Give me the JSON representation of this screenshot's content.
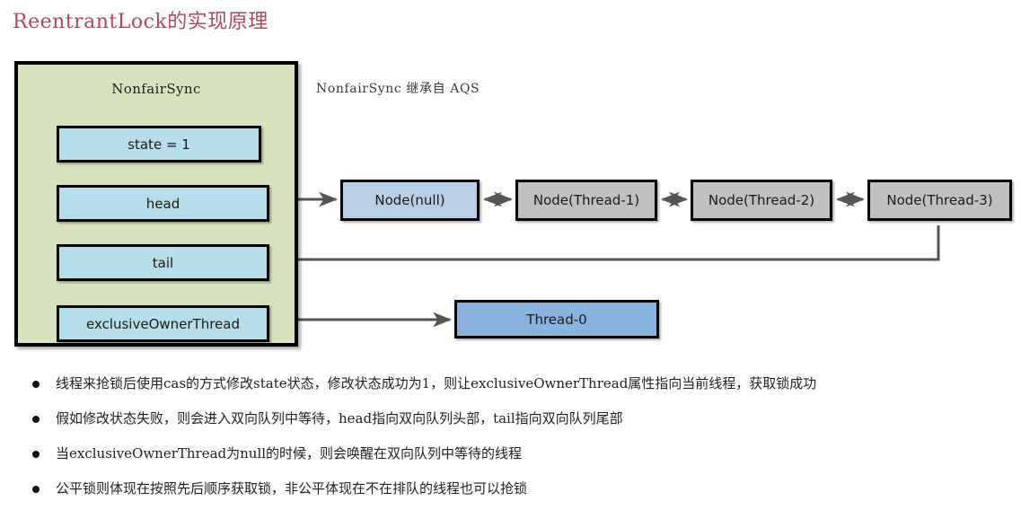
{
  "page": {
    "title": "ReentrantLock的实现原理",
    "title_color": "#b04a5a",
    "background": "#ffffff"
  },
  "diagram": {
    "sync_container": {
      "title": "NonfairSync",
      "fill": "#d6e3bc",
      "border": "#000000",
      "fields": [
        {
          "label": "state = 1",
          "fill": "#b7dee8"
        },
        {
          "label": "head",
          "fill": "#b7dee8"
        },
        {
          "label": "tail",
          "fill": "#b7dee8"
        },
        {
          "label": "exclusiveOwnerThread",
          "fill": "#b7dee8"
        }
      ]
    },
    "side_note": "NonfairSync 继承自 AQS",
    "queue_nodes": [
      {
        "label": "Node(null)",
        "fill": "#b9cde5"
      },
      {
        "label": "Node(Thread-1)",
        "fill": "#c0c0c0"
      },
      {
        "label": "Node(Thread-2)",
        "fill": "#c0c0c0"
      },
      {
        "label": "Node(Thread-3)",
        "fill": "#c0c0c0"
      }
    ],
    "owner_thread": {
      "label": "Thread-0",
      "fill": "#8ab2de"
    },
    "connector_color": "#555555",
    "connectors": [
      {
        "from": "head",
        "to": "Node(null)",
        "type": "single-arrow"
      },
      {
        "from": "Node(null)",
        "to": "Node(Thread-1)",
        "type": "double-arrow"
      },
      {
        "from": "Node(Thread-1)",
        "to": "Node(Thread-2)",
        "type": "double-arrow"
      },
      {
        "from": "Node(Thread-2)",
        "to": "Node(Thread-3)",
        "type": "double-arrow"
      },
      {
        "from": "Node(Thread-3)",
        "to": "tail",
        "type": "single-arrow"
      },
      {
        "from": "exclusiveOwnerThread",
        "to": "Thread-0",
        "type": "single-arrow"
      }
    ]
  },
  "notes": [
    "线程来抢锁后使用cas的方式修改state状态，修改状态成功为1，则让exclusiveOwnerThread属性指向当前线程，获取锁成功",
    "假如修改状态失败，则会进入双向队列中等待，head指向双向队列头部，tail指向双向队列尾部",
    "当exclusiveOwnerThread为null的时候，则会唤醒在双向队列中等待的线程",
    "公平锁则体现在按照先后顺序获取锁，非公平体现在不在排队的线程也可以抢锁"
  ]
}
